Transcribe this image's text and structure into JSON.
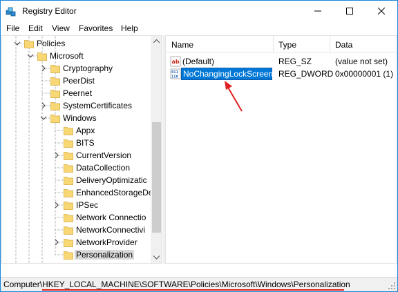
{
  "window": {
    "title": "Registry Editor"
  },
  "menu": [
    "File",
    "Edit",
    "View",
    "Favorites",
    "Help"
  ],
  "tree": {
    "items": [
      {
        "label": "Policies",
        "level": 1,
        "expanded": true,
        "has_children": true
      },
      {
        "label": "Microsoft",
        "level": 2,
        "expanded": true,
        "has_children": true
      },
      {
        "label": "Cryptography",
        "level": 3,
        "expanded": false,
        "has_children": true
      },
      {
        "label": "PeerDist",
        "level": 3,
        "expanded": false,
        "has_children": false
      },
      {
        "label": "Peernet",
        "level": 3,
        "expanded": false,
        "has_children": false
      },
      {
        "label": "SystemCertificates",
        "level": 3,
        "expanded": false,
        "has_children": true
      },
      {
        "label": "Windows",
        "level": 3,
        "expanded": true,
        "has_children": true
      },
      {
        "label": "Appx",
        "level": 4,
        "expanded": false,
        "has_children": false
      },
      {
        "label": "BITS",
        "level": 4,
        "expanded": false,
        "has_children": false
      },
      {
        "label": "CurrentVersion",
        "level": 4,
        "expanded": false,
        "has_children": true
      },
      {
        "label": "DataCollection",
        "level": 4,
        "expanded": false,
        "has_children": false
      },
      {
        "label": "DeliveryOptimizatic",
        "level": 4,
        "expanded": false,
        "has_children": false
      },
      {
        "label": "EnhancedStorageDe",
        "level": 4,
        "expanded": false,
        "has_children": false
      },
      {
        "label": "IPSec",
        "level": 4,
        "expanded": false,
        "has_children": true
      },
      {
        "label": "Network Connectio",
        "level": 4,
        "expanded": false,
        "has_children": false
      },
      {
        "label": "NetworkConnectivi",
        "level": 4,
        "expanded": false,
        "has_children": false
      },
      {
        "label": "NetworkProvider",
        "level": 4,
        "expanded": false,
        "has_children": true
      },
      {
        "label": "Personalization",
        "level": 4,
        "expanded": false,
        "has_children": false,
        "selected": true
      }
    ]
  },
  "list": {
    "columns": [
      "Name",
      "Type",
      "Data"
    ],
    "rows": [
      {
        "icon": "string-value-icon",
        "name": "(Default)",
        "type": "REG_SZ",
        "data": "(value not set)"
      },
      {
        "icon": "dword-value-icon",
        "name": "NoChangingLockScreen",
        "type": "REG_DWORD",
        "data": "0x00000001 (1)",
        "renaming": true
      }
    ]
  },
  "status": {
    "path": "Computer\\HKEY_LOCAL_MACHINE\\SOFTWARE\\Policies\\Microsoft\\Windows\\Personalization"
  },
  "colors": {
    "accent": "#0078d7",
    "annotation": "#e02020",
    "folder": "#f8d775"
  }
}
